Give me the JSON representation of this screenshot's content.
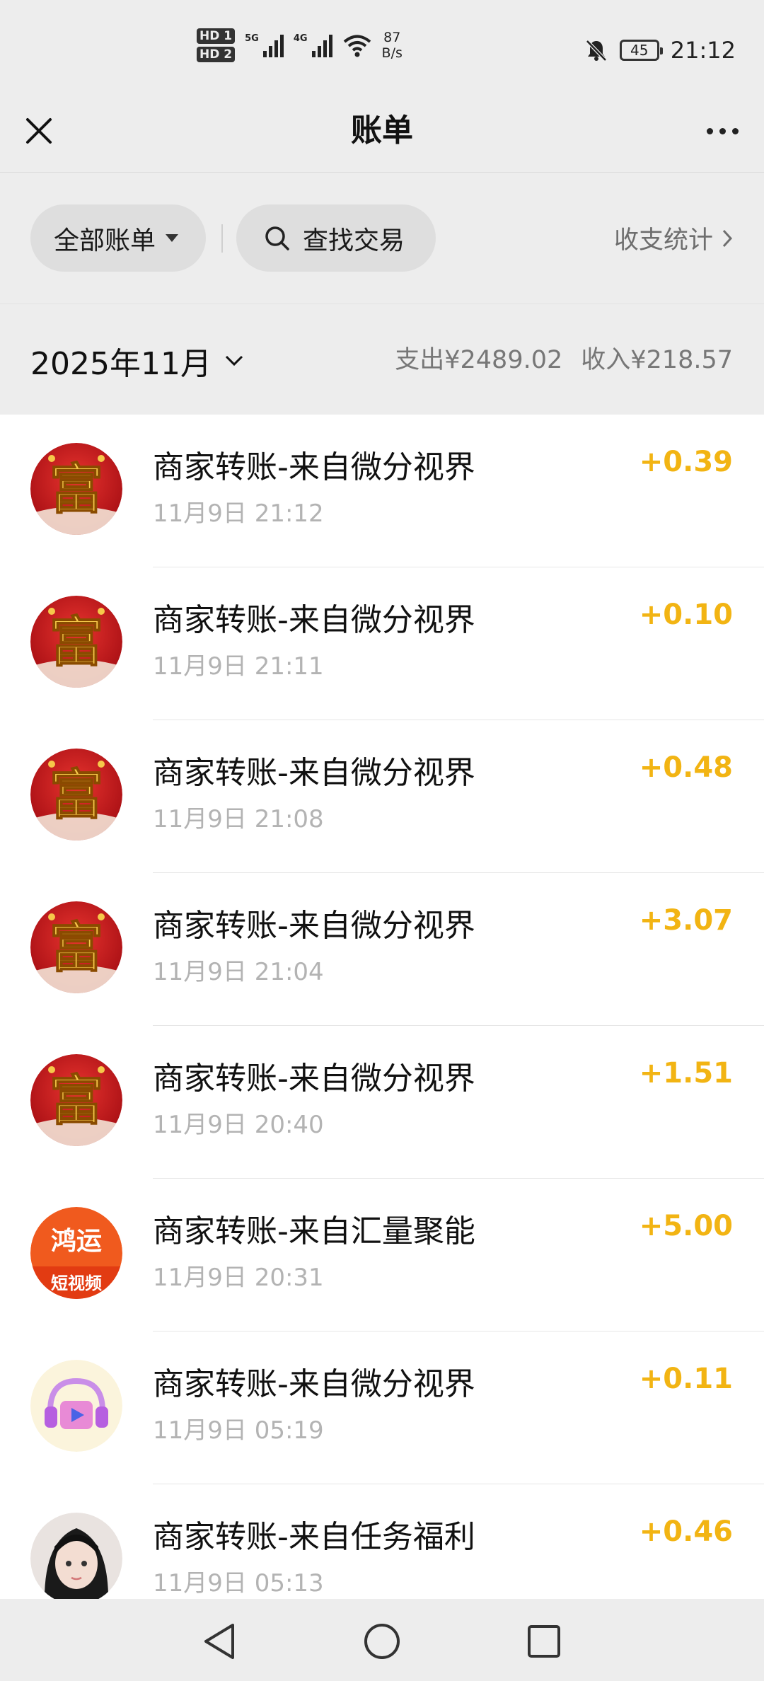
{
  "status_bar": {
    "sim1": "HD 1",
    "sim2": "HD 2",
    "net1": "5G",
    "net2": "4G",
    "speed_value": "87",
    "speed_unit": "B/s",
    "battery": "45",
    "time": "21:12"
  },
  "nav": {
    "title": "账单"
  },
  "filters": {
    "all_label": "全部账单",
    "search_label": "查找交易",
    "stats_label": "收支统计"
  },
  "month": {
    "label": "2025年11月",
    "expense": "支出¥2489.02",
    "income": "收入¥218.57"
  },
  "transactions": [
    {
      "title": "商家转账-来自微分视界",
      "time": "11月9日 21:12",
      "amount": "+0.39",
      "avatar": "fu-icon"
    },
    {
      "title": "商家转账-来自微分视界",
      "time": "11月9日 21:11",
      "amount": "+0.10",
      "avatar": "fu-icon"
    },
    {
      "title": "商家转账-来自微分视界",
      "time": "11月9日 21:08",
      "amount": "+0.48",
      "avatar": "fu-icon"
    },
    {
      "title": "商家转账-来自微分视界",
      "time": "11月9日 21:04",
      "amount": "+3.07",
      "avatar": "fu-icon"
    },
    {
      "title": "商家转账-来自微分视界",
      "time": "11月9日 20:40",
      "amount": "+1.51",
      "avatar": "fu-icon"
    },
    {
      "title": "商家转账-来自汇量聚能",
      "time": "11月9日 20:31",
      "amount": "+5.00",
      "avatar": "hongyun-icon",
      "avatar_text": "鸿运",
      "avatar_sub": "短视频"
    },
    {
      "title": "商家转账-来自微分视界",
      "time": "11月9日 05:19",
      "amount": "+0.11",
      "avatar": "headphone-video-icon"
    },
    {
      "title": "商家转账-来自任务福利",
      "time": "11月9日 05:13",
      "amount": "+0.46",
      "avatar": "girl-avatar-icon"
    }
  ],
  "fu_char": "富",
  "colors": {
    "amount": "#f2b413",
    "fu_red": "#c8141b",
    "fu_gold": "#f6c84a"
  }
}
